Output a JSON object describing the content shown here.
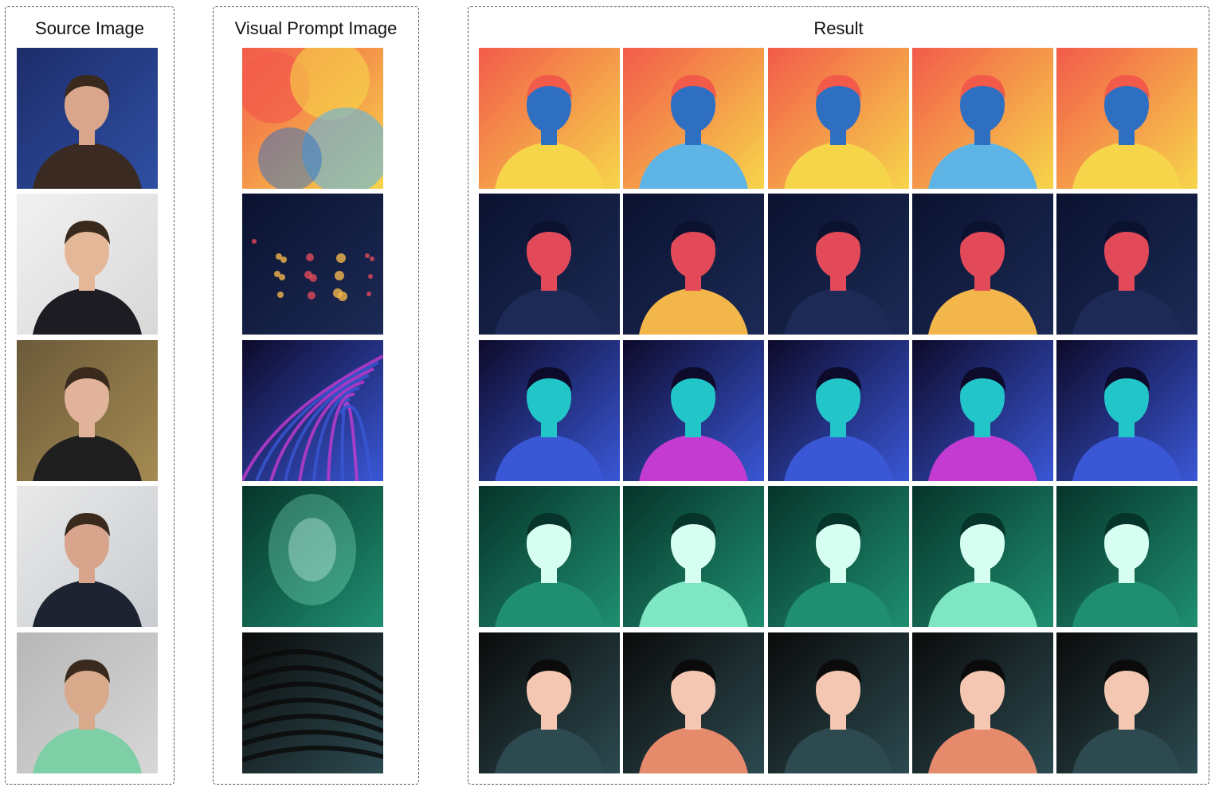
{
  "panels": {
    "source_title": "Source Image",
    "prompt_title": "Visual Prompt Image",
    "result_title": "Result"
  },
  "colors": {
    "frame_border": "#4a5568",
    "watercolor": [
      "#f25b4a",
      "#f7d54a",
      "#5fb4e6",
      "#2f6fc2"
    ],
    "night_bokeh": [
      "#0b1230",
      "#1c2a55",
      "#f2b64a",
      "#e24a5a"
    ],
    "neon_palm": [
      "#0d0a2a",
      "#3a57d6",
      "#c43bd1",
      "#22c6c9"
    ],
    "teal_glow": [
      "#06342a",
      "#1f8f70",
      "#7fe6c4",
      "#d7fff1"
    ],
    "graphic_novel": [
      "#0b0b0b",
      "#2c4a50",
      "#e58a6b",
      "#f3c7b1"
    ]
  },
  "icons": {
    "portrait": "person-portrait-icon",
    "style_texture": "style-texture-icon"
  }
}
